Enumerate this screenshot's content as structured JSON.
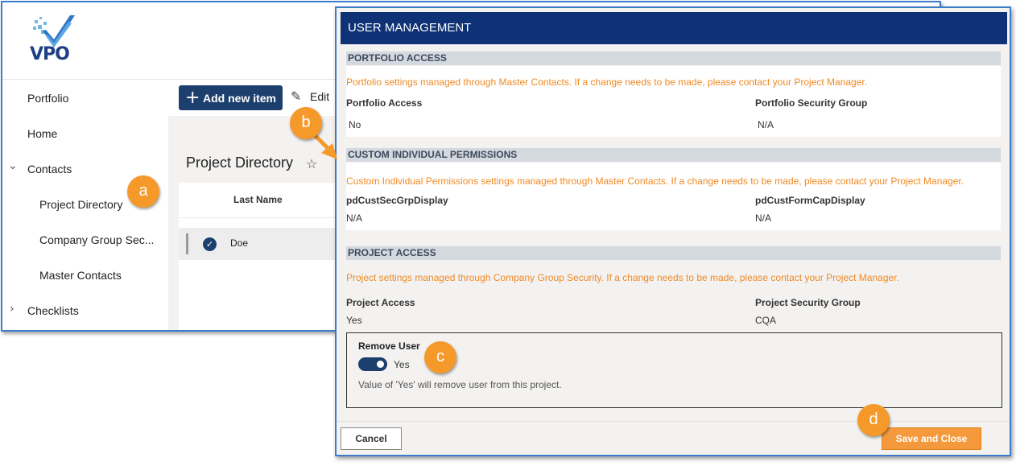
{
  "app": {
    "logo_text": "VPO",
    "nav": [
      {
        "label": "Portfolio"
      },
      {
        "label": "Home"
      },
      {
        "label": "Contacts",
        "chevron": "⌄"
      },
      {
        "label": "Project Directory"
      },
      {
        "label": "Company Group Sec..."
      },
      {
        "label": "Master Contacts"
      },
      {
        "label": "Checklists",
        "chevron": "›"
      }
    ],
    "toolbar": {
      "add_label": "Add new item",
      "add_icon": "+",
      "edit_label": "Edit"
    },
    "page_title": "Project Directory",
    "favorite_icon": "☆",
    "list": {
      "columns": [
        "Last Name"
      ],
      "rows": [
        {
          "last_name": "Doe",
          "selected": true
        }
      ]
    }
  },
  "callouts": {
    "a": "a",
    "b": "b",
    "c": "c",
    "d": "d",
    "color": "#f59a2a"
  },
  "modal": {
    "title": "USER MANAGEMENT",
    "sections": {
      "portfolio": {
        "heading": "PORTFOLIO ACCESS",
        "notice": "Portfolio settings managed through Master Contacts. If a change needs to be made, please contact your Project Manager.",
        "fields": [
          {
            "label": "Portfolio Access",
            "value": "No"
          },
          {
            "label": "Portfolio Security Group",
            "value": "N/A"
          }
        ]
      },
      "custom": {
        "heading": "CUSTOM INDIVIDUAL PERMISSIONS",
        "notice": "Custom Individual Permissions settings managed through Master Contacts. If a change needs to be made, please contact your Project Manager.",
        "fields": [
          {
            "label": "pdCustSecGrpDisplay",
            "value": "N/A"
          },
          {
            "label": "pdCustFormCapDisplay",
            "value": "N/A"
          }
        ]
      },
      "project": {
        "heading": "PROJECT ACCESS",
        "notice": "Project settings managed through Company Group Security. If a change needs to be made, please contact your Project Manager.",
        "fields": [
          {
            "label": "Project Access",
            "value": "Yes"
          },
          {
            "label": "Project Security Group",
            "value": "CQA"
          }
        ]
      }
    },
    "remove_user": {
      "title": "Remove User",
      "toggle_on": true,
      "toggle_label": "Yes",
      "help": "Value of 'Yes' will remove user from this project."
    },
    "buttons": {
      "cancel": "Cancel",
      "save": "Save and Close"
    }
  },
  "colors": {
    "brand_navy": "#0e3275",
    "accent_orange": "#f59a3c",
    "notice_orange": "#f08a24",
    "window_border": "#3d7cc9"
  }
}
